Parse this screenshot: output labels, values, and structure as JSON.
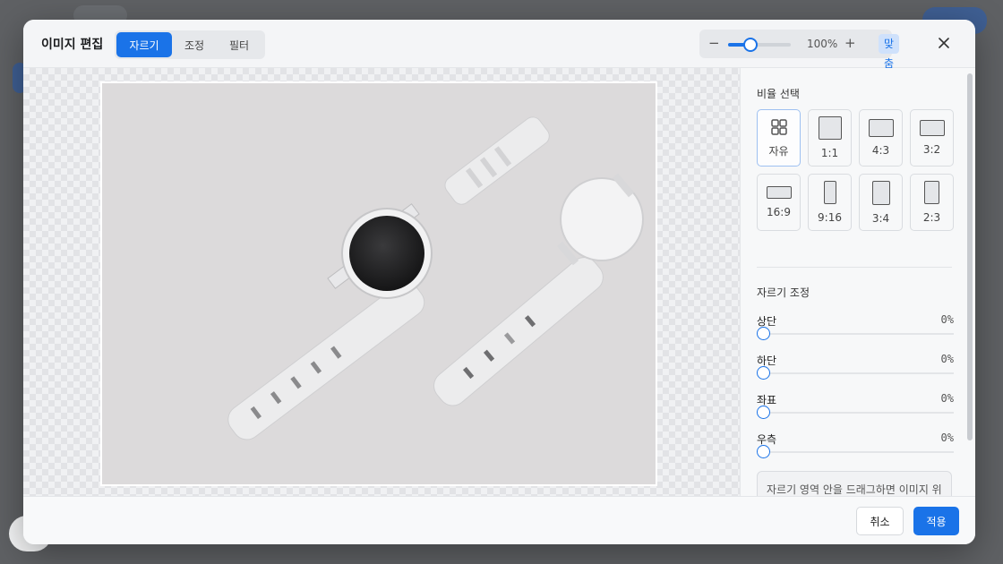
{
  "modal": {
    "title": "이미지 편집",
    "tabs": [
      {
        "label": "자르기",
        "active": true
      },
      {
        "label": "조정",
        "active": false
      },
      {
        "label": "필터",
        "active": false
      }
    ],
    "zoom": {
      "minus": "−",
      "plus": "+",
      "value_text": "100%",
      "slider_level": 0.36,
      "fit_label": "맞춤"
    },
    "close_icon": "close-icon"
  },
  "sidebar": {
    "ratio_title": "비율 선택",
    "ratios": [
      {
        "label": "자유",
        "icon": "grid-icon",
        "active": true
      },
      {
        "label": "1:1",
        "icon": "square-icon",
        "active": false
      },
      {
        "label": "4:3",
        "icon": "landscape-4-3-icon",
        "active": false
      },
      {
        "label": "3:2",
        "icon": "landscape-3-2-icon",
        "active": false
      },
      {
        "label": "16:9",
        "icon": "landscape-16-9-icon",
        "active": false
      },
      {
        "label": "9:16",
        "icon": "portrait-9-16-icon",
        "active": false
      },
      {
        "label": "3:4",
        "icon": "portrait-3-4-icon",
        "active": false
      },
      {
        "label": "2:3",
        "icon": "portrait-2-3-icon",
        "active": false
      }
    ],
    "crop_title": "자르기 조정",
    "adjustments": [
      {
        "label": "상단",
        "value": "0%"
      },
      {
        "label": "하단",
        "value": "0%"
      },
      {
        "label": "좌표",
        "value": "0%"
      },
      {
        "label": "우측",
        "value": "0%"
      }
    ],
    "hint": "자르기 영역 안을 드래그하면 이미지 위에 이동할 수 있습니다. 모서리/가장자"
  },
  "footer": {
    "cancel_label": "취소",
    "apply_label": "적용"
  },
  "colors": {
    "accent": "#1a73e8",
    "backdrop": "#5f6164"
  }
}
